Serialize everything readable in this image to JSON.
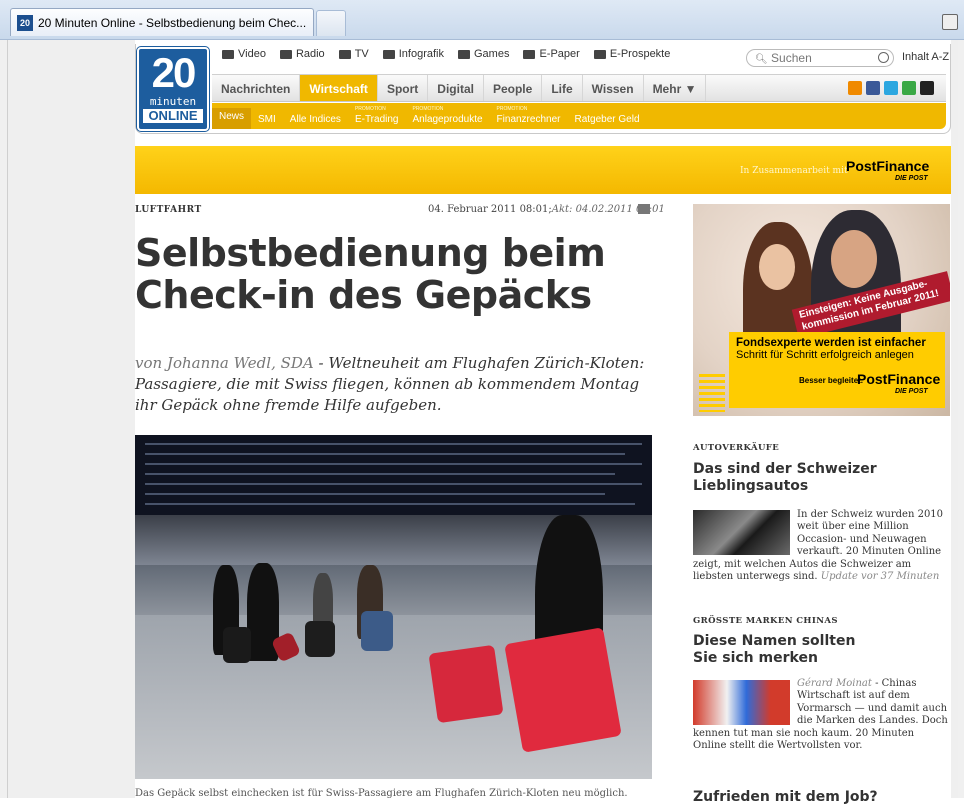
{
  "browser": {
    "tab_favicon": "20",
    "tab_title": "20 Minuten Online - Selbstbedienung beim Chec..."
  },
  "logo": {
    "number": "20",
    "minuten": "minuten",
    "online": "ONLINE"
  },
  "topnav": {
    "items": [
      "Video",
      "Radio",
      "TV",
      "Infografik",
      "Games",
      "E-Paper",
      "E-Prospekte"
    ],
    "search_placeholder": "Suchen",
    "inhalt": "Inhalt A-Z"
  },
  "mainnav": {
    "items": [
      "Nachrichten",
      "Wirtschaft",
      "Sport",
      "Digital",
      "People",
      "Life",
      "Wissen",
      "Mehr ▼"
    ],
    "active": "Wirtschaft"
  },
  "subnav": {
    "items": [
      "News",
      "SMI",
      "Alle Indices",
      "E-Trading",
      "Anlageprodukte",
      "Finanzrechner",
      "Ratgeber Geld"
    ],
    "promo_label": "PROMOTION"
  },
  "sponsor": {
    "in_zusammenarbeit": "In Zusammenarbeit mit",
    "brand": "PostFinance",
    "post": "DIE POST"
  },
  "article": {
    "rubric": "LUFTFAHRT",
    "date": "04. Februar 2011 08:01;",
    "updated": "Akt: 04.02.2011 08:01",
    "headline_1": "Selbstbedienung beim",
    "headline_2": "Check-in des Gepäcks",
    "author": "von Johanna Wedl, SDA",
    "lead": " - Weltneuheit am Flughafen Zürich-Kloten: Passagiere, die mit Swiss fliegen, können ab kommendem Montag ihr Gepäck ohne fremde Hilfe aufgeben.",
    "bottom_text": "Das Gepäck selbst einchecken ist für Swiss-Passagiere am Flughafen Zürich-Kloten neu möglich."
  },
  "ad": {
    "banner": "Einsteigen: Keine Ausgabe-kommission im Februar 2011!",
    "title": "Fondsexperte werden ist einfacher",
    "subtitle": "Schritt für Schritt erfolgreich anlegen",
    "slogan": "Besser begleitet.",
    "brand": "PostFinance",
    "post": "DIE POST"
  },
  "sidebar": {
    "s1_rubric": "AUTOVERKÄUFE",
    "s1_title": "Das sind der Schweizer Lieblingsautos",
    "s1_text": "In der Schweiz wurden 2010 weit über eine Million Occasion- und Neuwagen verkauft. 20 Minuten Online zeigt, mit welchen Autos die Schweizer am liebsten unterwegs sind.",
    "s1_update": "Update vor 37 Minuten",
    "s2_rubric": "GRÖSSTE MARKEN CHINAS",
    "s2_title": "Diese Namen sollten Sie sich merken",
    "s2_author": "Gérard Moinat",
    "s2_text": " - Chinas Wirtschaft ist auf dem Vormarsch — und damit auch die Marken des Landes. Doch kennen tut man sie noch kaum. 20 Minuten Online stellt die Wertvollsten vor.",
    "s3_title": "Zufrieden mit dem Job?"
  }
}
